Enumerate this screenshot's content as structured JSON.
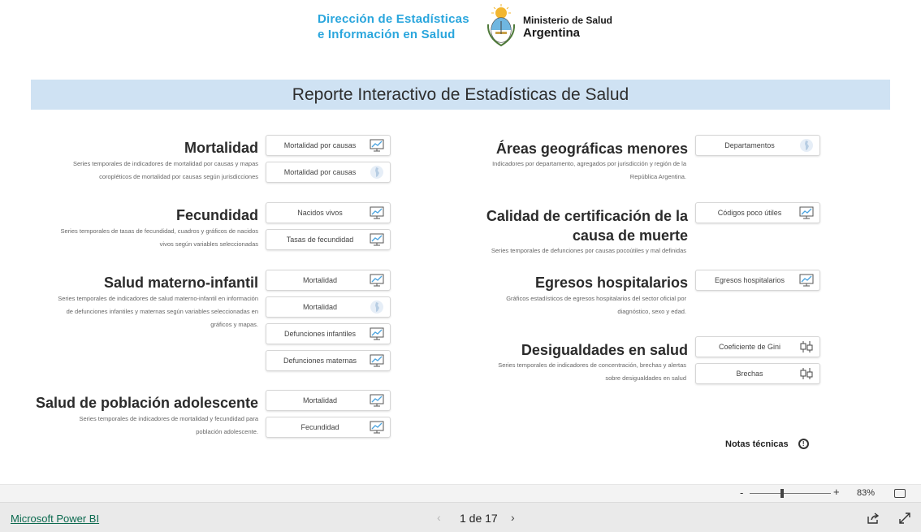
{
  "header": {
    "dir_line1": "Dirección de Estadísticas",
    "dir_line2": "e Información en Salud",
    "min_line1": "Ministerio de Salud",
    "min_line2": "Argentina",
    "report_title": "Reporte Interactivo de Estadísticas de Salud"
  },
  "sections": {
    "mortalidad": {
      "title": "Mortalidad",
      "desc1": "Series temporales de indicadores de mortalidad por causas y mapas",
      "desc2": "coropléticos de mortalidad por causas según jurisdicciones",
      "buttons": [
        "Mortalidad por causas",
        "Mortalidad por causas"
      ]
    },
    "fecundidad": {
      "title": "Fecundidad",
      "desc1": "Series temporales de tasas de fecundidad, cuadros y gráficos de nacidos",
      "desc2": "vivos según variables seleccionadas",
      "buttons": [
        "Nacidos vivos",
        "Tasas de fecundidad"
      ]
    },
    "materno": {
      "title": "Salud materno-infantil",
      "desc1": "Series temporales de indicadores de salud materno-infantil en información",
      "desc2": "de defunciones infantiles y maternas según variables seleccionadas en",
      "desc3": "gráficos y mapas.",
      "buttons": [
        "Mortalidad",
        "Mortalidad",
        "Defunciones infantiles",
        "Defunciones maternas"
      ]
    },
    "adolescente": {
      "title": "Salud de población adolescente",
      "desc1": "Series temporales de indicadores de mortalidad y fecundidad para",
      "desc2": "población adolescente.",
      "buttons": [
        "Mortalidad",
        "Fecundidad"
      ]
    },
    "areas": {
      "title": "Áreas geográficas menores",
      "desc1": "Indicadores por departamento, agregados por jurisdicción y región de la",
      "desc2": "República Argentina.",
      "buttons": [
        "Departamentos"
      ]
    },
    "calidad": {
      "title1": "Calidad de certificación de la",
      "title2": "causa de muerte",
      "desc1": "Series temporales de defunciones por causas pocoútiles y mal definidas",
      "buttons": [
        "Códigos poco útiles"
      ]
    },
    "egresos": {
      "title": "Egresos hospitalarios",
      "desc1": "Gráficos estadísticos de egresos hospitalarios del sector oficial por",
      "desc2": "diagnóstico, sexo y edad.",
      "buttons": [
        "Egresos hospitalarios"
      ]
    },
    "desigualdades": {
      "title": "Desigualdades en salud",
      "desc1": "Series temporales de indicadores de concentración, brechas y alertas",
      "desc2": "sobre desigualdades en salud",
      "buttons": [
        "Coeficiente de Gini",
        "Brechas"
      ]
    }
  },
  "notas": {
    "label": "Notas técnicas",
    "icon": "info-icon"
  },
  "zoom": {
    "minus": "-",
    "plus": "+",
    "value": "83%",
    "level": 0.4
  },
  "footer": {
    "brand": "Microsoft Power BI",
    "prev": "‹",
    "pages": "1 de 17",
    "next": "›"
  },
  "colors": {
    "banner": "#cfe2f3",
    "dir_blue": "#2aa6dd",
    "brand_green": "#0b6a4f"
  }
}
